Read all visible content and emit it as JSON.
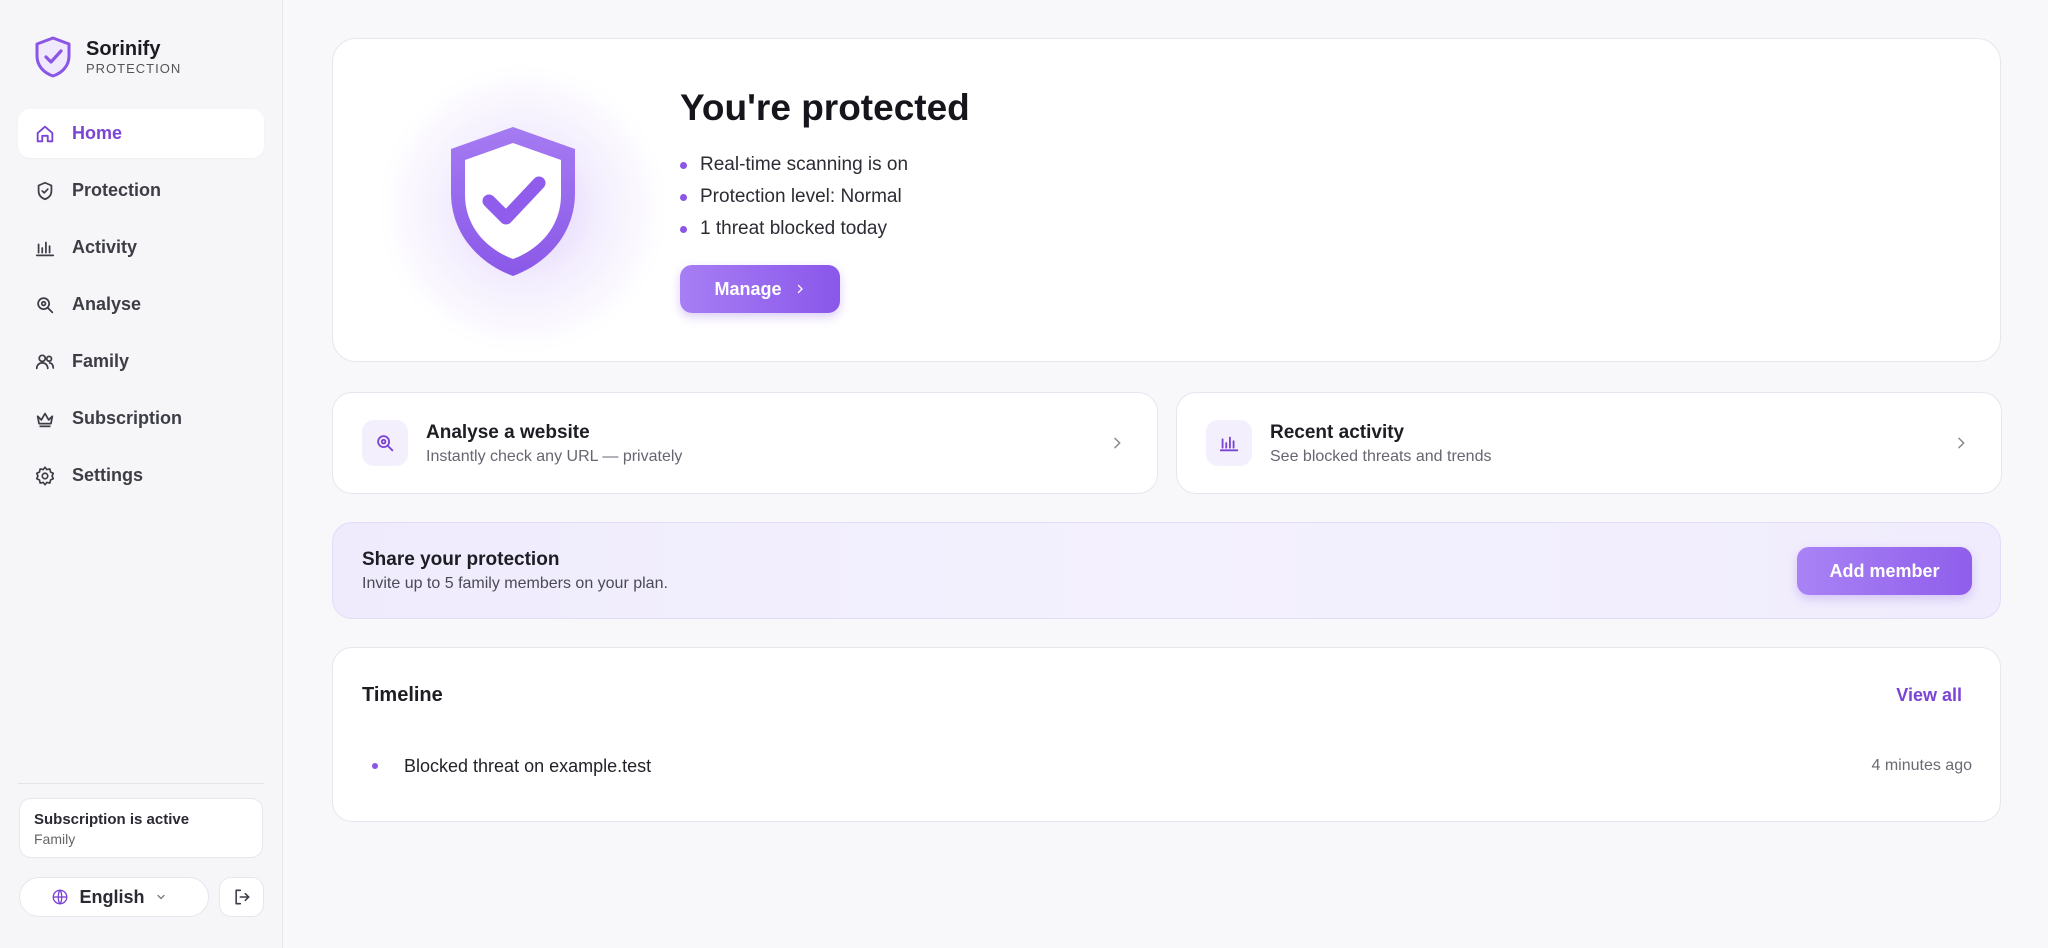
{
  "brand": {
    "name": "Sorinify",
    "tagline": "PROTECTION"
  },
  "sidebar": {
    "items": [
      {
        "label": "Home",
        "icon": "home-icon",
        "active": true
      },
      {
        "label": "Protection",
        "icon": "shield-icon",
        "active": false
      },
      {
        "label": "Activity",
        "icon": "bar-chart-icon",
        "active": false
      },
      {
        "label": "Analyse",
        "icon": "search-icon",
        "active": false
      },
      {
        "label": "Family",
        "icon": "users-icon",
        "active": false
      },
      {
        "label": "Subscription",
        "icon": "crown-icon",
        "active": false
      },
      {
        "label": "Settings",
        "icon": "gear-icon",
        "active": false
      }
    ],
    "subscription": {
      "status": "Subscription is active",
      "plan": "Family"
    },
    "language": "English"
  },
  "hero": {
    "title": "You're protected",
    "bullets": [
      "Real-time scanning is on",
      "Protection level: Normal",
      "1 threat blocked today"
    ],
    "manage_label": "Manage"
  },
  "tiles": [
    {
      "title": "Analyse a website",
      "subtitle": "Instantly check any URL — privately",
      "icon": "search-icon"
    },
    {
      "title": "Recent activity",
      "subtitle": "See blocked threats and trends",
      "icon": "bar-chart-icon"
    }
  ],
  "share": {
    "title": "Share your protection",
    "subtitle": "Invite up to 5 family members on your plan.",
    "button_label": "Add member"
  },
  "timeline": {
    "title": "Timeline",
    "view_all": "View all",
    "entries": [
      {
        "text": "Blocked threat on example.test",
        "time": "4 minutes ago"
      }
    ]
  },
  "colors": {
    "accent": "#7a44d6",
    "accent_light": "#a77ef4",
    "background": "#f8f8fb"
  }
}
